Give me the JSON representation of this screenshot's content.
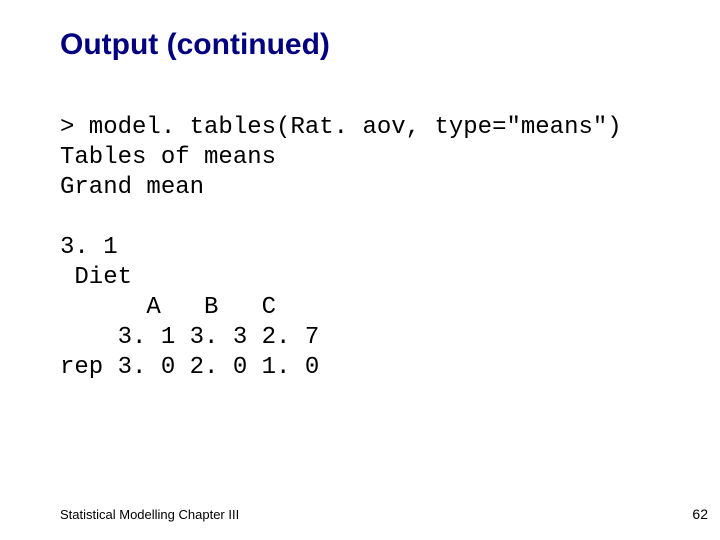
{
  "title": "Output (continued)",
  "code": {
    "l1": "> model. tables(Rat. aov, type=\"means\")",
    "l2": "Tables of means",
    "l3": "Grand mean",
    "l4": "",
    "l5": "3. 1",
    "l6": " Diet",
    "l7": "      A   B   C",
    "l8": "    3. 1 3. 3 2. 7",
    "l9": "rep 3. 0 2. 0 1. 0"
  },
  "footer": {
    "left": "Statistical Modelling   Chapter III",
    "page": "62"
  }
}
